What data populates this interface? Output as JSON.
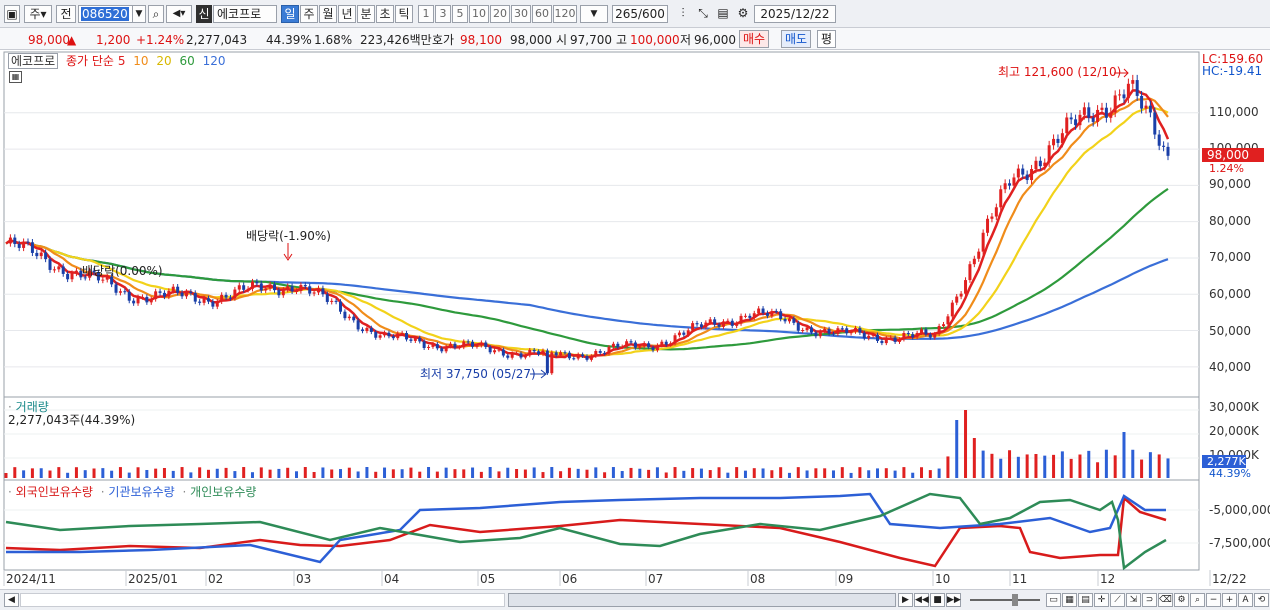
{
  "toolbar": {
    "market": "주",
    "scope": "전",
    "code": "086520",
    "badge": "신",
    "name": "에코프로",
    "periods": [
      "일",
      "주",
      "월",
      "년",
      "분",
      "초",
      "틱"
    ],
    "active_period": "일",
    "multipliers": [
      "1",
      "3",
      "5",
      "10",
      "20",
      "30",
      "60",
      "120"
    ],
    "count": "265",
    "total": "/600",
    "date": "2025/12/22"
  },
  "quote": {
    "price": "98,000",
    "change_arrow": "▲",
    "change": "1,200",
    "change_pct": "+1.24%",
    "volume": "2,277,043",
    "volume_ratio": "44.39%",
    "turnover": "1.68%",
    "amount": "223,426백만",
    "hoga_label": "호가",
    "ask": "98,100",
    "bid": "98,000",
    "open_label": "시",
    "open": "97,700",
    "high_label": "고",
    "high": "100,000",
    "low_label": "저",
    "low": "96,000",
    "buy_label": "매수",
    "sell_label": "매도",
    "avg_label": "평"
  },
  "price_panel": {
    "name_tag": "에코프로",
    "ma_label": "종가 단순",
    "ma_periods": [
      {
        "label": "5",
        "color": "#e02020"
      },
      {
        "label": "10",
        "color": "#f08c1a"
      },
      {
        "label": "20",
        "color": "#f2d21a"
      },
      {
        "label": "60",
        "color": "#2e9a3c"
      },
      {
        "label": "120",
        "color": "#3a6fd8"
      }
    ],
    "lc": "LC:159.60",
    "hc": "HC:-19.41",
    "high_annotation": "최고 121,600 (12/10)",
    "low_annotation": "최저 37,750 (05/27)",
    "dividend1": "배당락(-1.90%)",
    "dividend2": "배당락(0.00%)",
    "current_price": "98,000",
    "current_pct": "1.24%",
    "y_ticks": [
      "110,000",
      "100,000",
      "90,000",
      "80,000",
      "70,000",
      "60,000",
      "50,000",
      "40,000"
    ]
  },
  "volume_panel": {
    "title": "거래량",
    "value": "2,277,043주(44.39%)",
    "y_ticks": [
      "30,000K",
      "20,000K",
      "10,000K"
    ],
    "current": "2,277K",
    "current_pct": "44.39%"
  },
  "holdings_panel": {
    "series": [
      {
        "name": "외국인보유수량",
        "color": "#d81b1b"
      },
      {
        "name": "기관보유수량",
        "color": "#2c5fd6"
      },
      {
        "name": "개인보유수량",
        "color": "#2e8b57"
      }
    ],
    "y_ticks": [
      "-5,000,000",
      "-7,500,000"
    ]
  },
  "x_axis": [
    "2024/11",
    "2025/01",
    "02",
    "03",
    "04",
    "05",
    "06",
    "07",
    "08",
    "09",
    "10",
    "11",
    "12",
    "12/22"
  ],
  "chart_data": {
    "type": "candlestick",
    "x": [
      "2024/11",
      "2025/01",
      "02",
      "03",
      "04",
      "05",
      "06",
      "07",
      "08",
      "09",
      "10",
      "11",
      "12/10",
      "12/22"
    ],
    "close": [
      74000,
      60000,
      59000,
      63000,
      48000,
      45000,
      43000,
      46000,
      55000,
      49000,
      48000,
      92000,
      118000,
      98000
    ],
    "high": 121600,
    "low": 37750,
    "ylim": [
      35000,
      124000
    ]
  }
}
